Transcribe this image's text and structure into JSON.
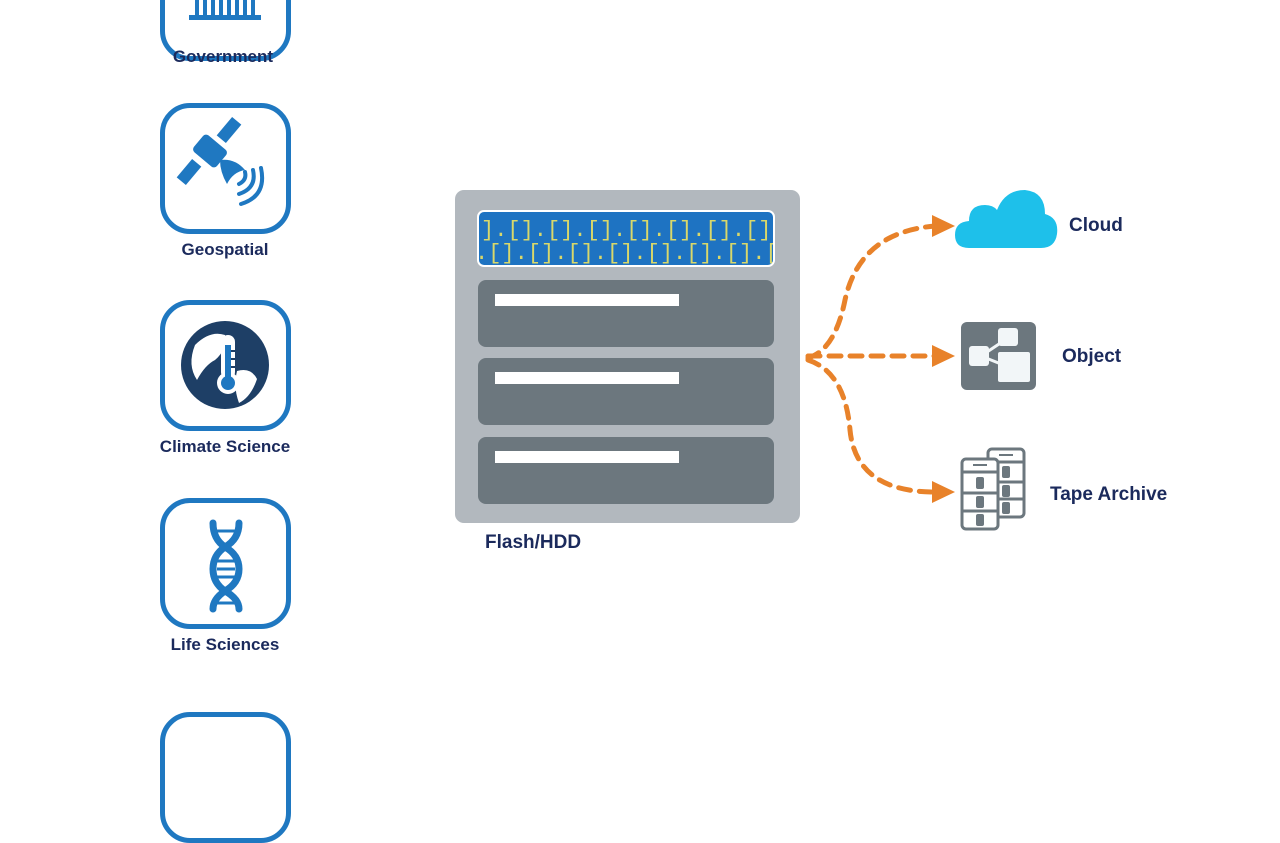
{
  "industries": [
    {
      "label": "Government",
      "icon": "government-building-icon"
    },
    {
      "label": "Geospatial",
      "icon": "satellite-icon"
    },
    {
      "label": "Climate Science",
      "icon": "globe-thermometer-icon"
    },
    {
      "label": "Life Sciences",
      "icon": "dna-icon"
    }
  ],
  "storage": {
    "label": "Flash/HDD",
    "display_pattern_row1": "].[].[].[].[].[].[].[].[].[",
    "display_pattern_row2": ".[].[].[].[].[].[].[].[].[]"
  },
  "targets": [
    {
      "label": "Cloud",
      "icon": "cloud-icon"
    },
    {
      "label": "Object",
      "icon": "object-storage-icon"
    },
    {
      "label": "Tape Archive",
      "icon": "tape-archive-icon"
    }
  ],
  "colors": {
    "icon_blue": "#1f78c1",
    "label_navy": "#1b2a5c",
    "arrow_orange": "#e8822a",
    "cloud_cyan": "#1ec0ea",
    "server_gray": "#b2b8be",
    "drive_gray": "#6c777e",
    "display_blue": "#1e73c2",
    "display_yellow": "#d9d86a"
  }
}
